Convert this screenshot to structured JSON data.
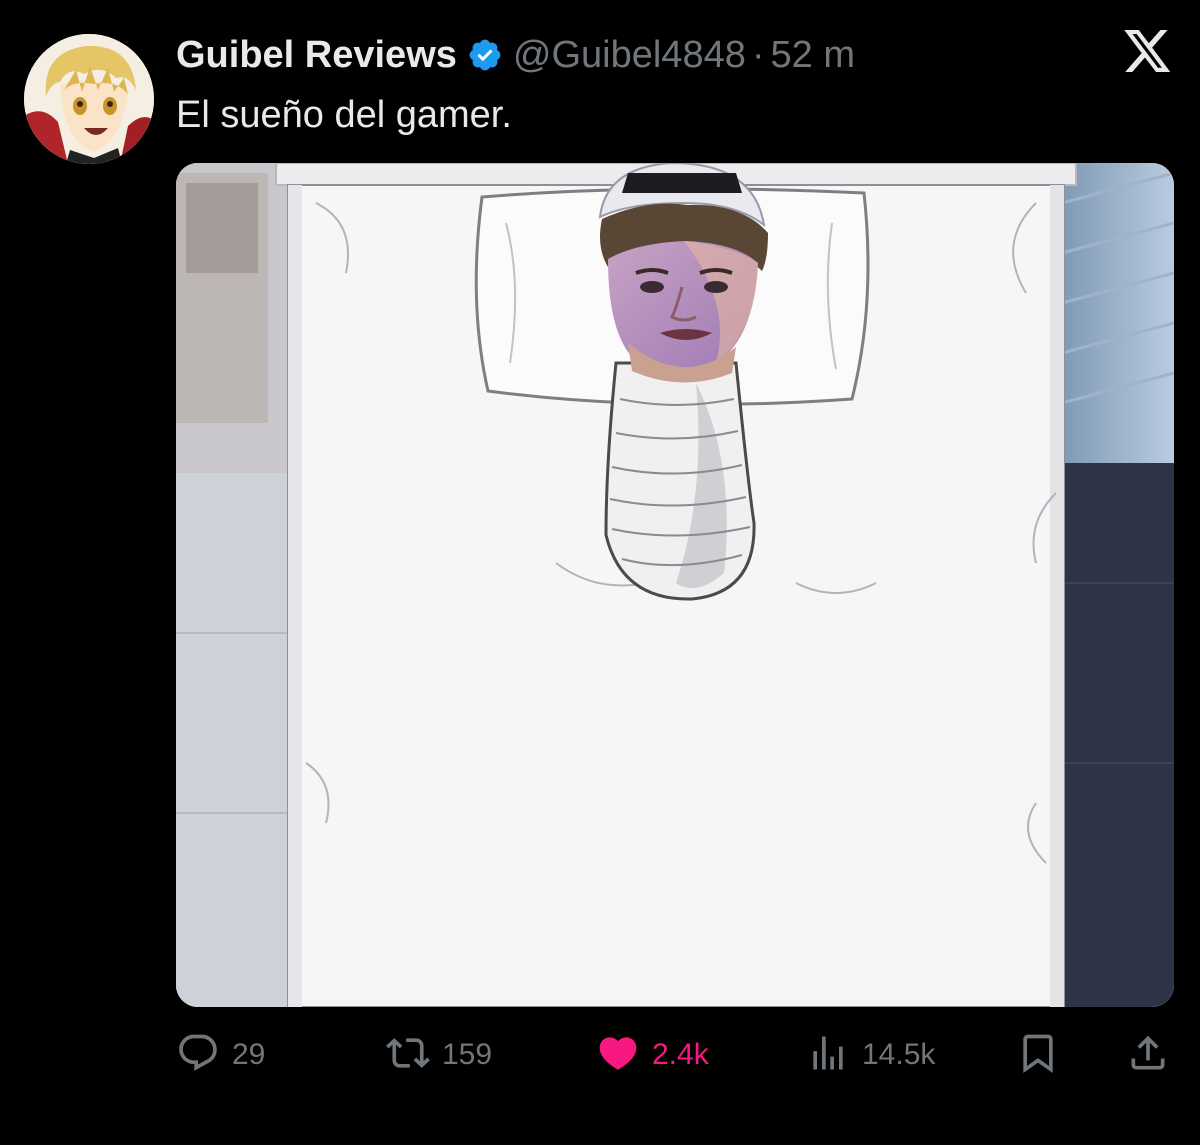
{
  "post": {
    "display_name": "Guibel Reviews",
    "handle": "@Guibel4848",
    "separator": "·",
    "time": "52 m",
    "text": "El sueño del gamer.",
    "verified": true
  },
  "actions": {
    "replies": "29",
    "reposts": "159",
    "likes": "2.4k",
    "views": "14.5k",
    "liked": true
  },
  "icons": {
    "verified": "verified-badge-icon",
    "platform": "x-logo-icon",
    "reply": "reply-icon",
    "repost": "repost-icon",
    "like": "heart-icon",
    "views": "views-icon",
    "bookmark": "bookmark-icon",
    "share": "share-icon"
  },
  "colors": {
    "background": "#000000",
    "primary_text": "#e7e9ea",
    "secondary_text": "#71767b",
    "verified_blue": "#1d9bf0",
    "like_pink": "#f91880"
  }
}
